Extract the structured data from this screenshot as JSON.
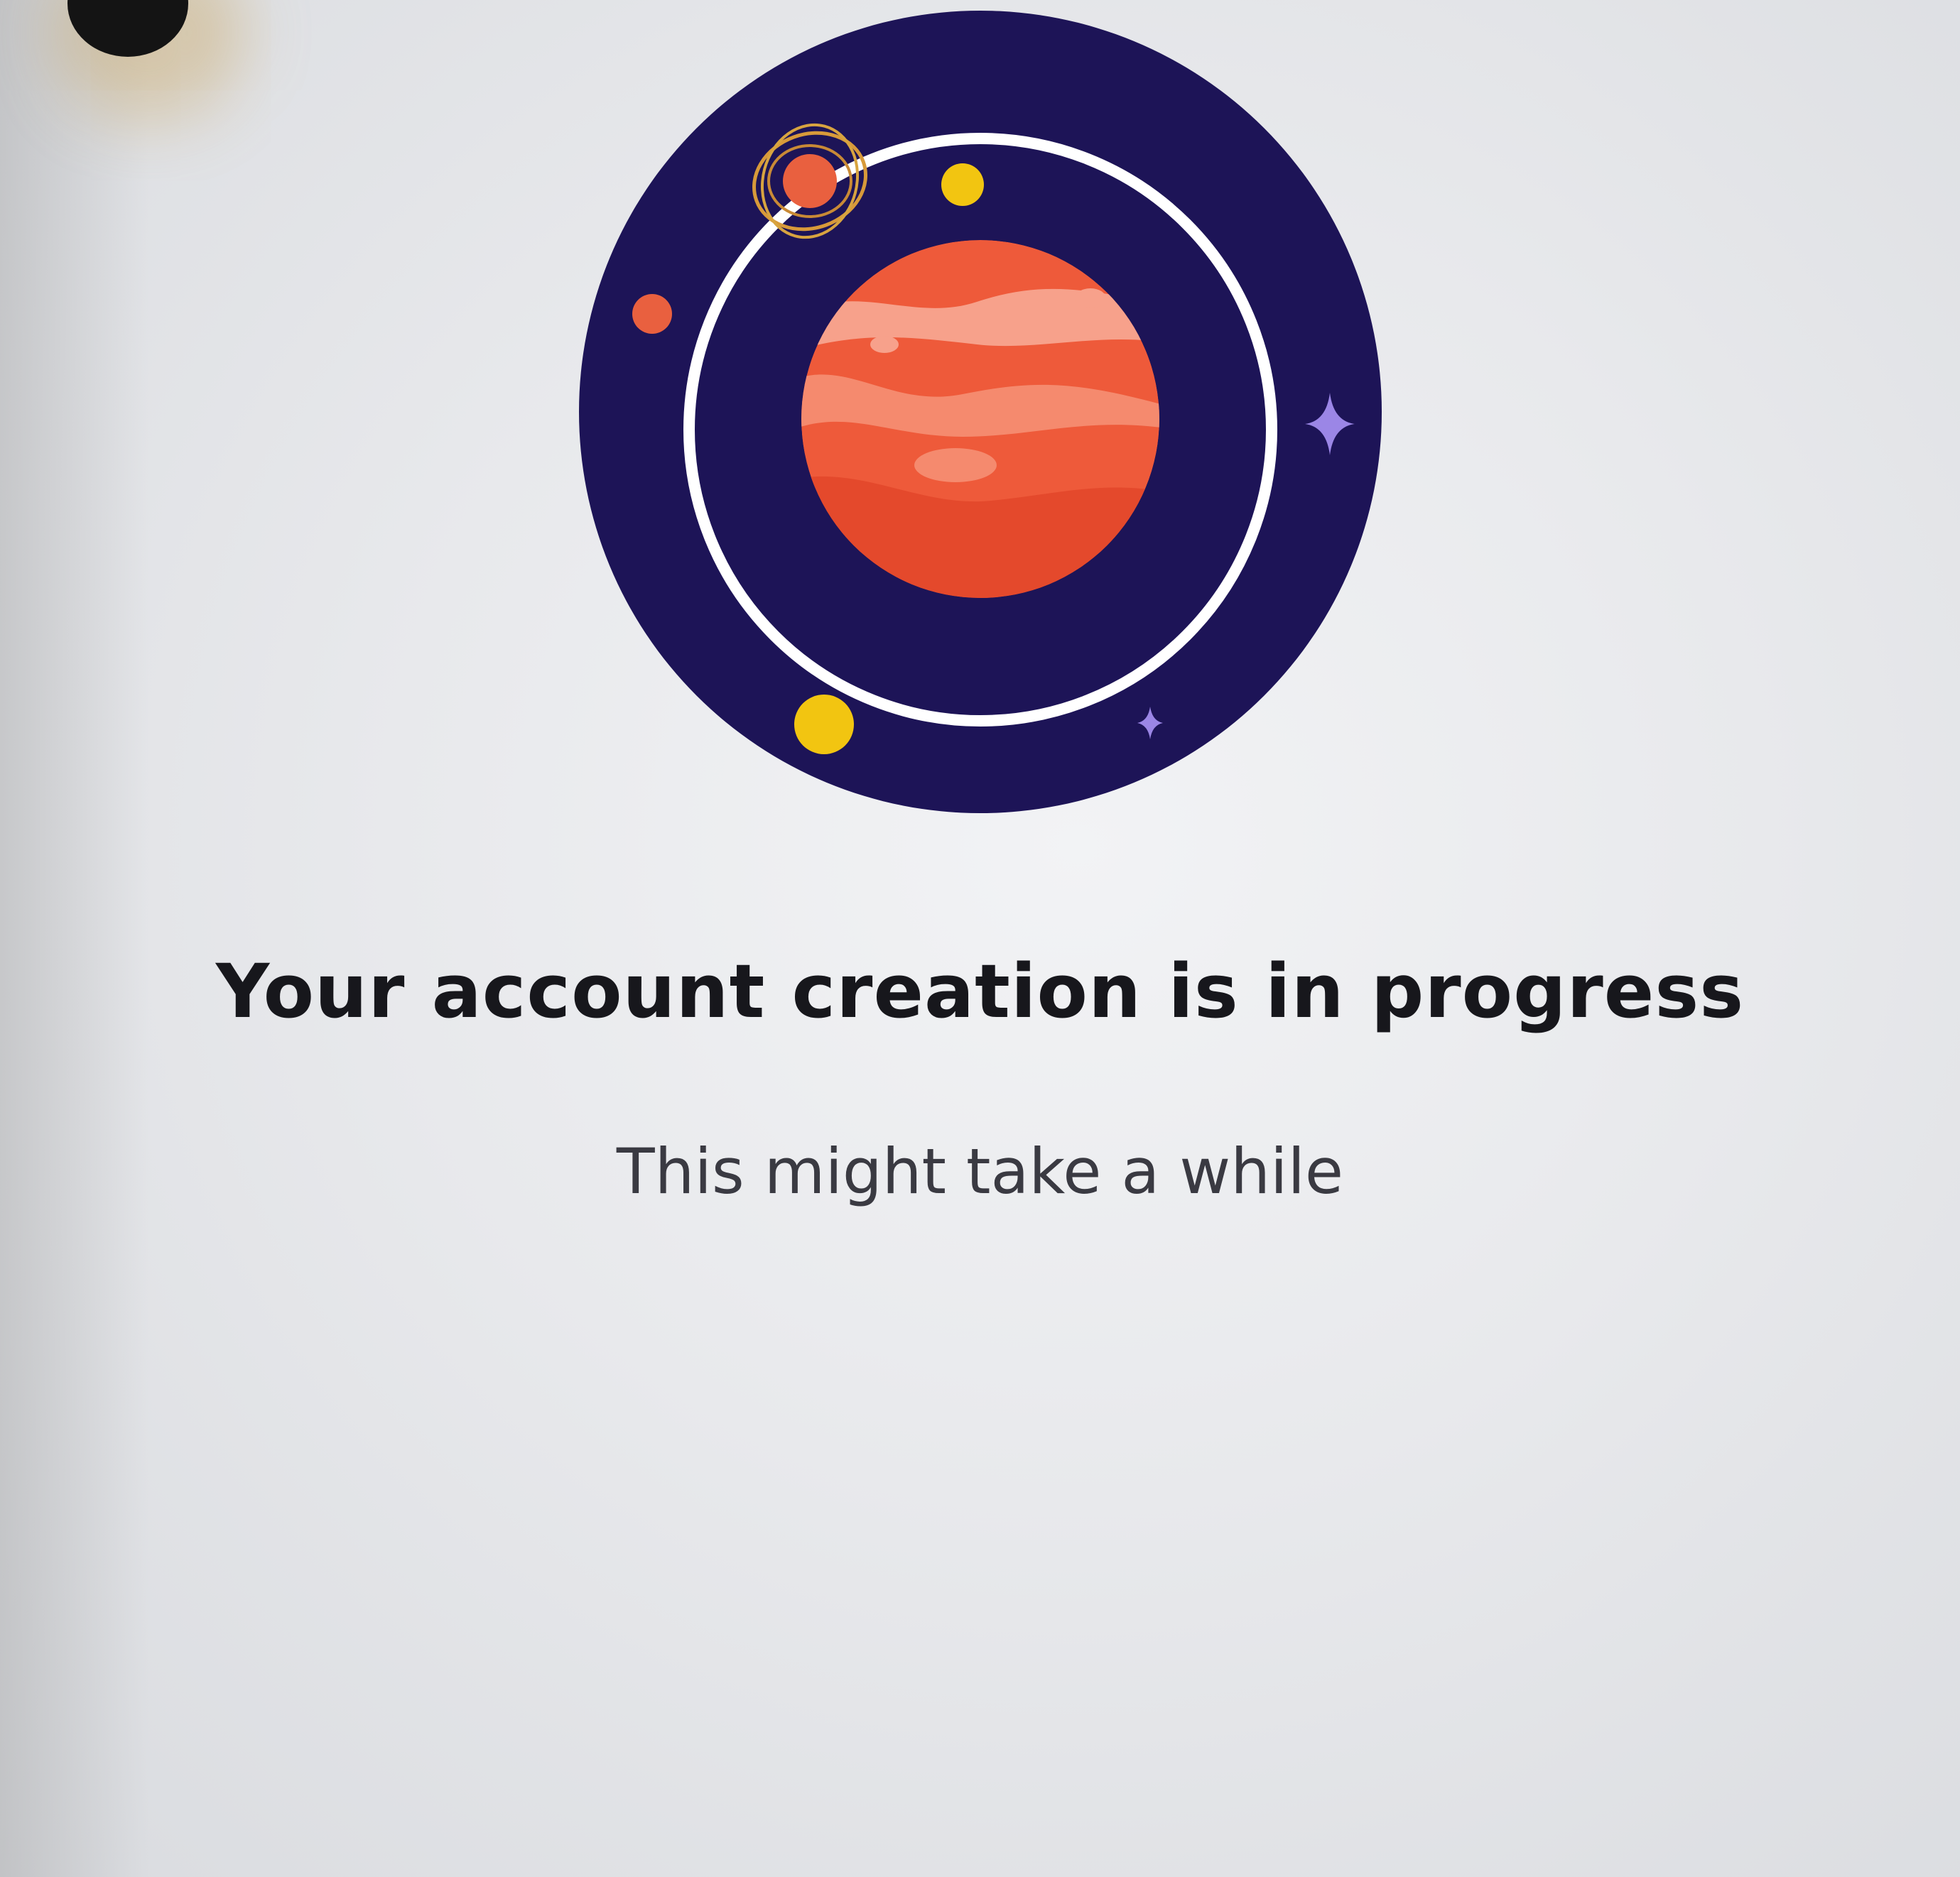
{
  "screen": {
    "title": "Your account creation is in progress",
    "subtitle": "This might take a while"
  },
  "illustration": {
    "icon": "planet-orbit-illustration-icon",
    "colors": {
      "space": "#1d1457",
      "planet": "#ee5a3a",
      "planet_bands": "#f7a18b",
      "orbit_ring": "#ffffff",
      "moon_yellow": "#f2c511",
      "moon_orange": "#e9603f",
      "sparkle": "#9b86e6"
    }
  }
}
